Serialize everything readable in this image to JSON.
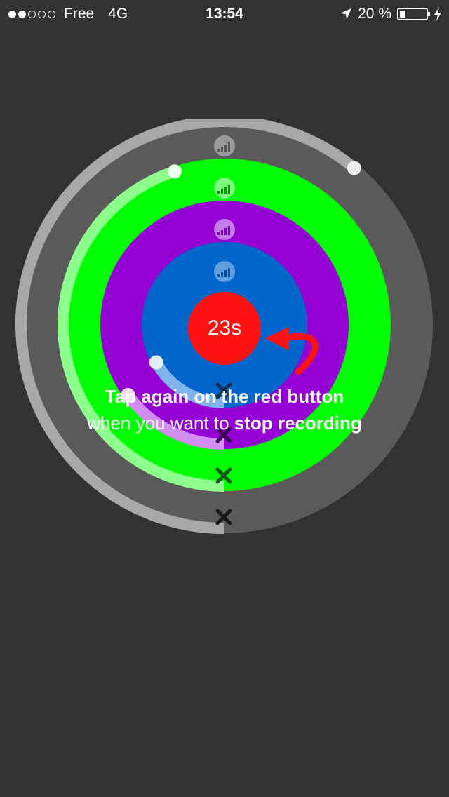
{
  "status_bar": {
    "signal_dots": [
      true,
      true,
      false,
      false,
      false
    ],
    "carrier": "Free",
    "network": "4G",
    "time": "13:54",
    "location_icon": "location-arrow-icon",
    "battery_text": "20 %",
    "battery_level": 0.2,
    "charging_icon": "bolt-icon"
  },
  "colors": {
    "background": "#323232",
    "ring_gray": "#5a5a5a",
    "ring_green": "#00ff00",
    "ring_purple": "#9400d3",
    "ring_blue": "#0066cc",
    "record_red": "#ff1212"
  },
  "tracks": [
    {
      "name": "track-gray",
      "icon": "equalizer-icon",
      "delete_icon": "delete-x-icon",
      "progress": 0.61
    },
    {
      "name": "track-green",
      "icon": "equalizer-icon",
      "delete_icon": "delete-x-icon",
      "progress": 0.45
    },
    {
      "name": "track-purple",
      "icon": "equalizer-icon",
      "delete_icon": "delete-x-icon",
      "progress": 0.15
    },
    {
      "name": "track-blue",
      "icon": "equalizer-icon",
      "delete_icon": "delete-x-icon",
      "progress": 0.17
    }
  ],
  "record_button": {
    "label": "23s"
  },
  "hint": {
    "line1": "Tap again on the red button",
    "line2_plain": "when you want to ",
    "line2_bold": "stop recording"
  }
}
